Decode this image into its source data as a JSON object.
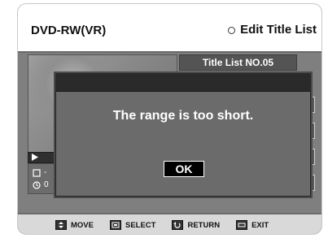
{
  "header": {
    "disc_type": "DVD-RW(VR)",
    "menu_title": "Edit Title List"
  },
  "title_list": {
    "label": "Title List NO.05"
  },
  "dialog": {
    "message": "The range is too short.",
    "ok_label": "OK"
  },
  "footer": {
    "items": [
      {
        "label": "MOVE",
        "icon": "up-down-arrows-icon"
      },
      {
        "label": "SELECT",
        "icon": "select-button-icon"
      },
      {
        "label": "RETURN",
        "icon": "return-arrow-icon"
      },
      {
        "label": "EXIT",
        "icon": "menu-exit-icon"
      }
    ]
  },
  "info": {
    "row1_text": "-",
    "row2_text": "0"
  }
}
